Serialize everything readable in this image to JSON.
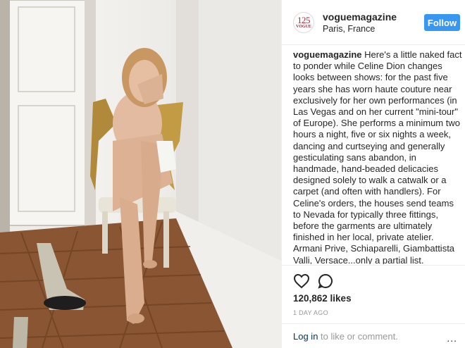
{
  "post": {
    "avatar_number": "125",
    "avatar_brand": "VOGUE",
    "username": "voguemagazine",
    "location": "Paris, France",
    "follow_label": "Follow"
  },
  "caption": {
    "username": "voguemagazine",
    "text": "Here's a little naked fact to ponder while Celine Dion changes looks between shows: for the past five years she has worn haute couture near exclusively for her own performances (in Las Vegas and on her current \"mini-tour\" of Europe). She performs a minimum two hours a night, five or six nights a week, dancing and curtseying and generally gesticulating sans abandon, in handmade, hand-beaded delicacies designed solely to walk a catwalk or a carpet (and often with handlers). For Celine's orders, the houses send teams to Nevada for typically three fittings, before the garments are ultimately finished in her local, private atelier. Armani Prive, Schiaparelli, Giambattista Valli, Versace...only a partial list. Everyone, basically. In Vegas, Velcro"
  },
  "stats": {
    "likes": "120,862 likes",
    "time": "1 DAY AGO"
  },
  "footer": {
    "login_label": "Log in",
    "login_suffix": " to like or comment.",
    "more": "..."
  },
  "icons": {
    "like": "heart-icon",
    "comment": "comment-icon",
    "more": "more-options-icon"
  },
  "colors": {
    "follow": "#3897f0",
    "login_link": "#003569",
    "vogue_red": "#b3213a"
  }
}
